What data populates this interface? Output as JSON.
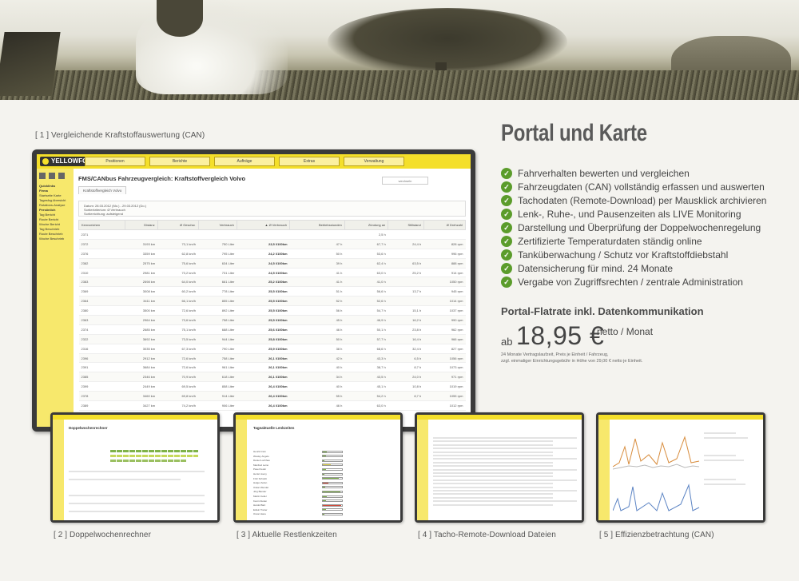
{
  "captions": {
    "main": "[ 1 ]  Vergleichende Kraftstoffauswertung (CAN)",
    "t2": "[ 2 ]  Doppelwochenrechner",
    "t3": "[ 3 ]  Aktuelle Restlenkzeiten",
    "t4": "[ 4 ]  Tacho-Remote-Download Dateien",
    "t5": "[ 5 ]  Effizienzbetrachtung (CAN)"
  },
  "heading": "Portal und Karte",
  "features": [
    "Fahrverhalten bewerten und vergleichen",
    "Fahrzeugdaten (CAN) vollständig erfassen und auswerten",
    "Tachodaten (Remote-Download) per Mausklick archivieren",
    "Lenk-, Ruhe-, und Pausenzeiten als LIVE Monitoring",
    "Darstellung und Überprüfung der Doppelwochenregelung",
    "Zertifizierte Temperaturdaten ständig online",
    "Tanküberwachung / Schutz vor Kraftstoffdiebstahl",
    "Datensicherung für mind. 24 Monate",
    "Vergabe von Zugriffsrechten / zentrale Administration"
  ],
  "pricing": {
    "flat_title": "Portal-Flatrate inkl. Datenkommunikation",
    "ab": "ab",
    "price": "18,95 €",
    "unit": "netto / Monat",
    "note_line1": "24 Monate Vertragslaufzeit, Preis je Einheit / Fahrzeug,",
    "note_line2": "zzgl. einmaliger Einrichtungsgebühr in Höhe von 29,00 € netto je Einheit."
  },
  "screen": {
    "logo": "YELLOWFOX",
    "nav": [
      "Positionen",
      "Berichte",
      "Aufträge",
      "Extras",
      "Verwaltung"
    ],
    "side_items": [
      "Quicklinks",
      "Firma",
      "Startseite Karte",
      "Tagesfzg.übersicht",
      "Rotations-Analyse",
      "Persönlich",
      "Tag Bericht",
      "Route Bericht",
      "Woche Bericht",
      "Tag Beschrieb",
      "Route Beschrieb",
      "Woche Beschrieb"
    ],
    "title": "FMS/CANbus Fahrzeugvergleich: Kraftstoffvergleich Volvo",
    "search": "wechseln",
    "tab": "Kraftstoffvergleich Volvo",
    "info_lines": [
      "Datum:  28.03.2012 (Mo.) - 29.03.2012 (Do.)",
      "Sortierkriterium:  Ø Verbrauch",
      "Sortierrichtung:  aufsteigend"
    ],
    "columns": [
      "Kennzeichen",
      "Distanz",
      "Ø Geschw.",
      "Verbrauch",
      "▲ Ø Verbrauch",
      "Betriebsstunden",
      "Zündung an",
      "Stillstand",
      "Ø Drehzahl"
    ],
    "rows": [
      [
        "2371",
        "",
        "",
        "",
        "",
        "",
        "2,5 h",
        "",
        ""
      ],
      [
        "2372",
        "3193 km",
        "73,1 km/h",
        "750 Liter",
        "23,5 l/100km",
        "47 h",
        "67,7 h",
        "24,4 h",
        "828 rpm"
      ],
      [
        "2376",
        "3359 km",
        "62,8 km/h",
        "795 Liter",
        "24,2 l/100km",
        "50 h",
        "53,6 h",
        "",
        "996 rpm"
      ],
      [
        "2382",
        "2575 km",
        "75,6 km/h",
        "634 Liter",
        "24,5 l/100km",
        "39 h",
        "62,4 h",
        "63,5 h",
        "888 rpm"
      ],
      [
        "2310",
        "2981 km",
        "73,2 km/h",
        "731 Liter",
        "24,5 l/100km",
        "41 h",
        "63,0 h",
        "25,2 h",
        "914 rpm"
      ],
      [
        "2383",
        "2698 km",
        "64,0 km/h",
        "661 Liter",
        "25,2 l/100km",
        "41 h",
        "41,0 h",
        "",
        "1050 rpm"
      ],
      [
        "2369",
        "3008 km",
        "60,2 km/h",
        "778 Liter",
        "25,5 l/100km",
        "51 h",
        "56,6 h",
        "13,7 h",
        "945 rpm"
      ],
      [
        "2364",
        "3411 km",
        "66,1 km/h",
        "855 Liter",
        "25,5 l/100km",
        "52 h",
        "52,6 h",
        "",
        "1014 rpm"
      ],
      [
        "2380",
        "3500 km",
        "72,6 km/h",
        "892 Liter",
        "25,5 l/100km",
        "56 h",
        "54,7 h",
        "15,1 h",
        "1037 rpm"
      ],
      [
        "2363",
        "2964 km",
        "73,6 km/h",
        "758 Liter",
        "25,5 l/100km",
        "45 h",
        "46,9 h",
        "16,2 h",
        "990 rpm"
      ],
      [
        "2374",
        "2685 km",
        "75,1 km/h",
        "688 Liter",
        "25,6 l/100km",
        "46 h",
        "50,1 h",
        "23,8 h",
        "962 rpm"
      ],
      [
        "2322",
        "3692 km",
        "73,5 km/h",
        "944 Liter",
        "25,8 l/100km",
        "50 h",
        "57,7 h",
        "16,4 h",
        "966 rpm"
      ],
      [
        "2316",
        "3035 km",
        "67,3 km/h",
        "790 Liter",
        "25,9 l/100km",
        "38 h",
        "68,6 h",
        "32,4 h",
        "827 rpm"
      ],
      [
        "2396",
        "2912 km",
        "72,6 km/h",
        "758 Liter",
        "26,1 l/100km",
        "42 h",
        "43,3 h",
        "6,5 h",
        "1056 rpm"
      ],
      [
        "2391",
        "3684 km",
        "72,6 km/h",
        "961 Liter",
        "26,1 l/100km",
        "40 h",
        "38,7 h",
        "8,7 h",
        "1073 rpm"
      ],
      [
        "2385",
        "2346 km",
        "70,9 km/h",
        "618 Liter",
        "26,1 l/100km",
        "34 h",
        "43,5 h",
        "24,0 h",
        "971 rpm"
      ],
      [
        "2399",
        "2449 km",
        "69,5 km/h",
        "858 Liter",
        "26,4 l/100km",
        "40 h",
        "45,1 h",
        "10,8 h",
        "1019 rpm"
      ],
      [
        "2378",
        "3460 km",
        "69,8 km/h",
        "914 Liter",
        "26,4 l/100km",
        "55 h",
        "54,2 h",
        "8,7 h",
        "1055 rpm"
      ],
      [
        "2389",
        "3427 km",
        "74,2 km/h",
        "906 Liter",
        "26,4 l/100km",
        "46 h",
        "63,0 h",
        "",
        "1012 rpm"
      ]
    ]
  },
  "thumbs": {
    "t2_title": "Doppelwochenrechner",
    "t3_title": "Tageaktuelle Lenkzeiten",
    "t3_names": [
      "Henrik Irwin",
      "Wesley Angelo",
      "Daniel Lochhau",
      "Manfred Leino",
      "Pavel Fedor",
      "Hertel Joeny",
      "Fritz Schuldt",
      "Holger Aufen",
      "Oskar Wendel",
      "Jörg Bander",
      "Martin Keller",
      "Kevin Duden",
      "Harold Bart",
      "Edwin Treiter",
      "Oscar Hanu"
    ]
  },
  "colors": {
    "brand_yellow": "#f4df2a",
    "check_green": "#5b9c2b",
    "frame": "#3a3a3a"
  }
}
